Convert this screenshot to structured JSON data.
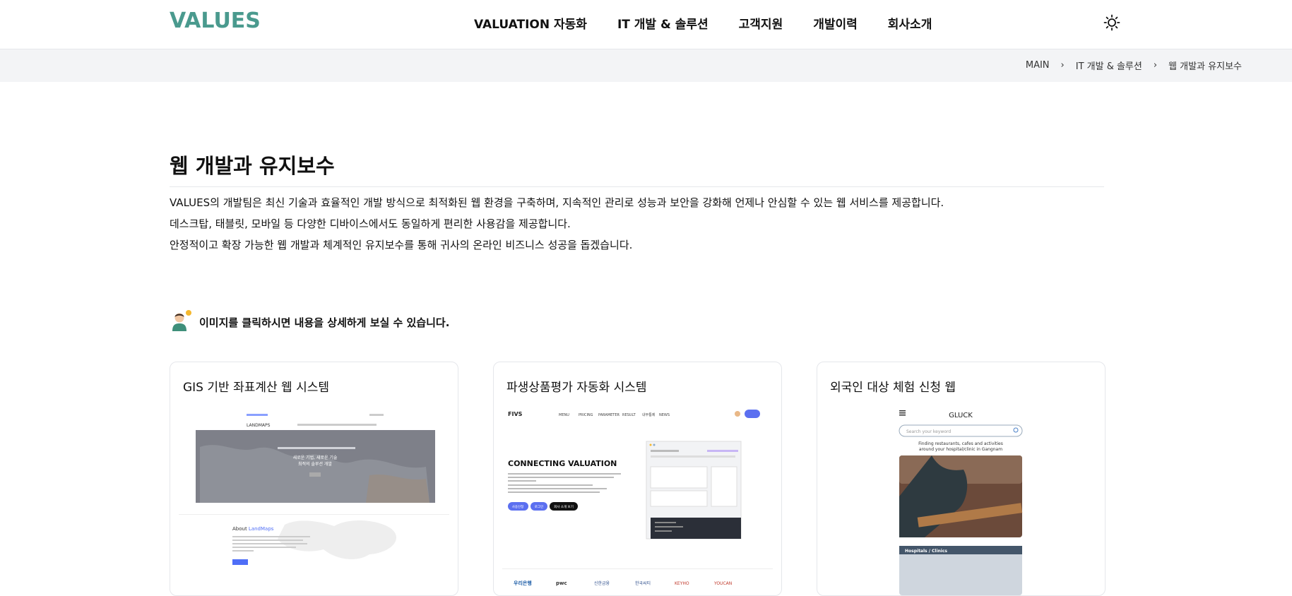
{
  "header": {
    "logo": "VALUES",
    "nav": [
      "VALUATION 자동화",
      "IT 개발 & 솔루션",
      "고객지원",
      "개발이력",
      "회사소개"
    ],
    "theme_icon": "sun-icon"
  },
  "breadcrumb": {
    "items": [
      "MAIN",
      "IT 개발 & 솔루션",
      "웹 개발과 유지보수"
    ],
    "separator": "›"
  },
  "main": {
    "title": "웹 개발과 유지보수",
    "intro": [
      "VALUES의 개발팀은 최신 기술과 효율적인 개발 방식으로 최적화된 웹 환경을 구축하며, 지속적인 관리로 성능과 보안을 강화해 언제나 안심할 수 있는 웹 서비스를 제공합니다.",
      "데스크탑, 태블릿, 모바일 등 다양한 디바이스에서도 동일하게 편리한 사용감을 제공합니다.",
      "안정적이고 확장 가능한 웹 개발과 체계적인 유지보수를 통해 귀사의 온라인 비즈니스 성공을 돕겠습니다."
    ],
    "hint": "이미지를 클릭하시면 내용을 상세하게 보실 수 있습니다.",
    "hint_icon": "developer-avatar-icon"
  },
  "cards": [
    {
      "title": "GIS 기반 좌표계산 웹 시스템",
      "thumb": {
        "brand": "LANDMAPS",
        "hero_line1": "새로운 기법, 새로운 기술",
        "hero_line2": "최적의 솔루션 개발",
        "about_prefix": "About ",
        "about_highlight": "LandMaps"
      }
    },
    {
      "title": "파생상품평가 자동화 시스템",
      "thumb": {
        "brand": "FIVS",
        "menu": [
          "MENU",
          "PRICING",
          "PARAMETER",
          "RESULT",
          "내부통제",
          "NEWS"
        ],
        "heading": "CONNECTING VALUATION",
        "buttons": [
          "사용신청",
          "로그인",
          "회사 소개 보기"
        ],
        "partners": [
          "우리은행",
          "pwc",
          "신한금융",
          "한국씨티",
          "KEYHO",
          "YOUCAN"
        ]
      }
    },
    {
      "title": "외국인 대상 체험 신청 웹",
      "thumb": {
        "brand": "GLUCK",
        "search_placeholder": "Search your keyword",
        "tagline1": "Finding restaurants, cafes and activities",
        "tagline2": "around your hospital/clinic in Gangnam",
        "section": "Hospitals / Clinics"
      }
    }
  ],
  "colors": {
    "brand": "#4a9a8e",
    "accent_blue": "#5b6ff0",
    "breadcrumb_bg": "#f3f4f6"
  }
}
